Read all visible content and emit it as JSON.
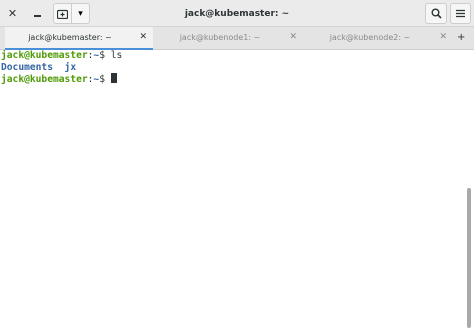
{
  "window": {
    "title": "jack@kubemaster: ~",
    "close_glyph": "✕",
    "new_tab_glyph": "▾"
  },
  "tabs": [
    {
      "label": "jack@kubemaster: ~",
      "close": "✕"
    },
    {
      "label": "jack@kubenode1: ~",
      "close": "✕"
    },
    {
      "label": "jack@kubenode2: ~",
      "close": "✕"
    }
  ],
  "tab_add": "+",
  "terminal": {
    "lines": [
      {
        "user": "jack@kubemaster",
        "sep": ":",
        "path": "~",
        "symbol": "$ ",
        "command": "ls"
      },
      {
        "output": [
          "Documents",
          "jx"
        ]
      },
      {
        "user": "jack@kubemaster",
        "sep": ":",
        "path": "~",
        "symbol": "$ ",
        "command": ""
      }
    ]
  },
  "colors": {
    "prompt_user": "#4e9a06",
    "prompt_path": "#3465a4",
    "directory": "#3465a4",
    "active_tab_accent": "#4a90d9"
  },
  "icons": {
    "close": "close-icon",
    "minimize": "minimize-icon",
    "new_tab": "new-tab-icon",
    "dropdown": "chevron-down-icon",
    "search": "search-icon",
    "menu": "hamburger-menu-icon"
  }
}
